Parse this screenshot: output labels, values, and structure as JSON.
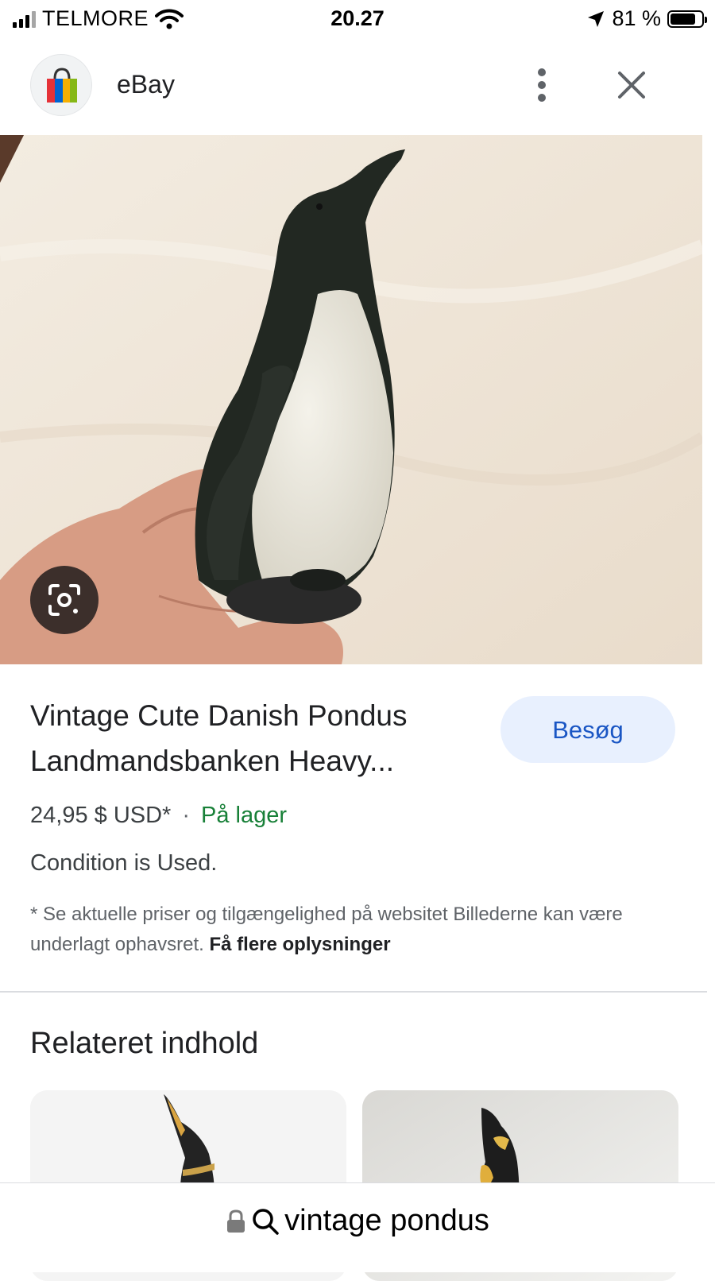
{
  "status_bar": {
    "carrier": "TELMORE",
    "time": "20.27",
    "battery_percent": "81 %",
    "battery_level": 0.81
  },
  "header": {
    "site_name": "eBay",
    "logo_icon": "shopping-bag-icon"
  },
  "product": {
    "image_subject": "vintage penguin figurine held in hand",
    "title": "Vintage Cute Danish Pondus Landmandsbanken Heavy...",
    "visit_label": "Besøg",
    "price": "24,95 $ USD*",
    "separator": "·",
    "stock_status": "På lager",
    "condition": "Condition is Used.",
    "disclaimer_text": "* Se aktuelle priser og tilgængelighed på websitet Billederne kan være underlagt ophavsret.",
    "disclaimer_link": "Få flere oplysninger"
  },
  "related": {
    "title": "Relateret indhold",
    "cards": [
      {
        "subject": "penguin figurine"
      },
      {
        "subject": "penguin figurine"
      }
    ]
  },
  "address_bar": {
    "query": "vintage pondus"
  },
  "colors": {
    "accent_blue": "#1a56c4",
    "visit_button_bg": "#e8f0fe",
    "stock_green": "#188038"
  }
}
